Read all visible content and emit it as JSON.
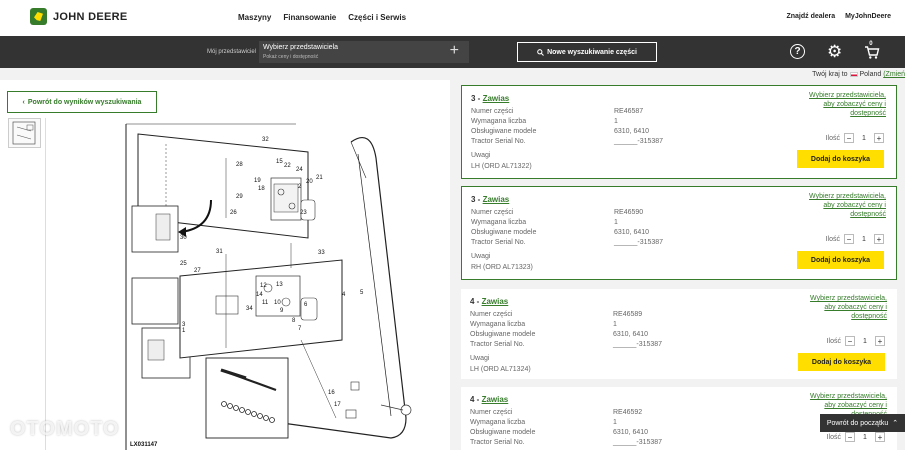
{
  "brand": {
    "name": "JOHN DEERE"
  },
  "nav": {
    "links": [
      "Maszyny",
      "Finansowanie",
      "Części i Serwis"
    ],
    "right": [
      "Znajdź dealera",
      "MyJohnDeere"
    ]
  },
  "toolbar": {
    "dealer_label": "Mój przedstawiciel",
    "dealer_title": "Wybierz przedstawiciela",
    "dealer_sub": "Pokaż ceny i dostępność",
    "new_search": "Nowe wyszukiwanie części",
    "cart_count": "0"
  },
  "country": {
    "prefix": "Twój kraj to",
    "name": "Poland",
    "change": "(Zmień"
  },
  "left": {
    "back_label": "Powrót do wyników wyszukiwania",
    "diagram_id": "LX031147"
  },
  "labels": {
    "part_no": "Numer części",
    "qty_req": "Wymagana liczba",
    "models": "Obsługiwane modele",
    "serial": "Tractor Serial No.",
    "notes": "Uwagi",
    "select_dealer": "Wybierz przedstawiciela, aby zobaczyć ceny i dostępność",
    "qty": "Ilość",
    "add": "Dodaj do koszyka"
  },
  "results": [
    {
      "pos": "3 -",
      "name": "Zawias",
      "part": "RE46587",
      "qty": "1",
      "models": "6310, 6410",
      "serial": "______-315387",
      "note": "LH (ORD AL71322)",
      "count": "1"
    },
    {
      "pos": "3 -",
      "name": "Zawias",
      "part": "RE46590",
      "qty": "1",
      "models": "6310, 6410",
      "serial": "______-315387",
      "note": "RH (ORD AL71323)",
      "count": "1"
    },
    {
      "pos": "4 -",
      "name": "Zawias",
      "part": "RE46589",
      "qty": "1",
      "models": "6310, 6410",
      "serial": "______-315387",
      "note": "LH (ORD AL71324)",
      "count": "1"
    },
    {
      "pos": "4 -",
      "name": "Zawias",
      "part": "RE46592",
      "qty": "1",
      "models": "6310, 6410",
      "serial": "______-315387",
      "note": "",
      "count": "1"
    }
  ],
  "back_to_top": "Powrót do początku",
  "watermark": "OTOMOTO",
  "diagram_callouts": [
    "32",
    "29",
    "15",
    "26",
    "28",
    "22",
    "24",
    "20",
    "21",
    "2",
    "19",
    "18",
    "23",
    "33",
    "30",
    "31",
    "25",
    "27",
    "34",
    "14",
    "11",
    "12",
    "13",
    "10",
    "9",
    "8",
    "7",
    "6",
    "5",
    "4",
    "3",
    "1",
    "16",
    "17"
  ]
}
